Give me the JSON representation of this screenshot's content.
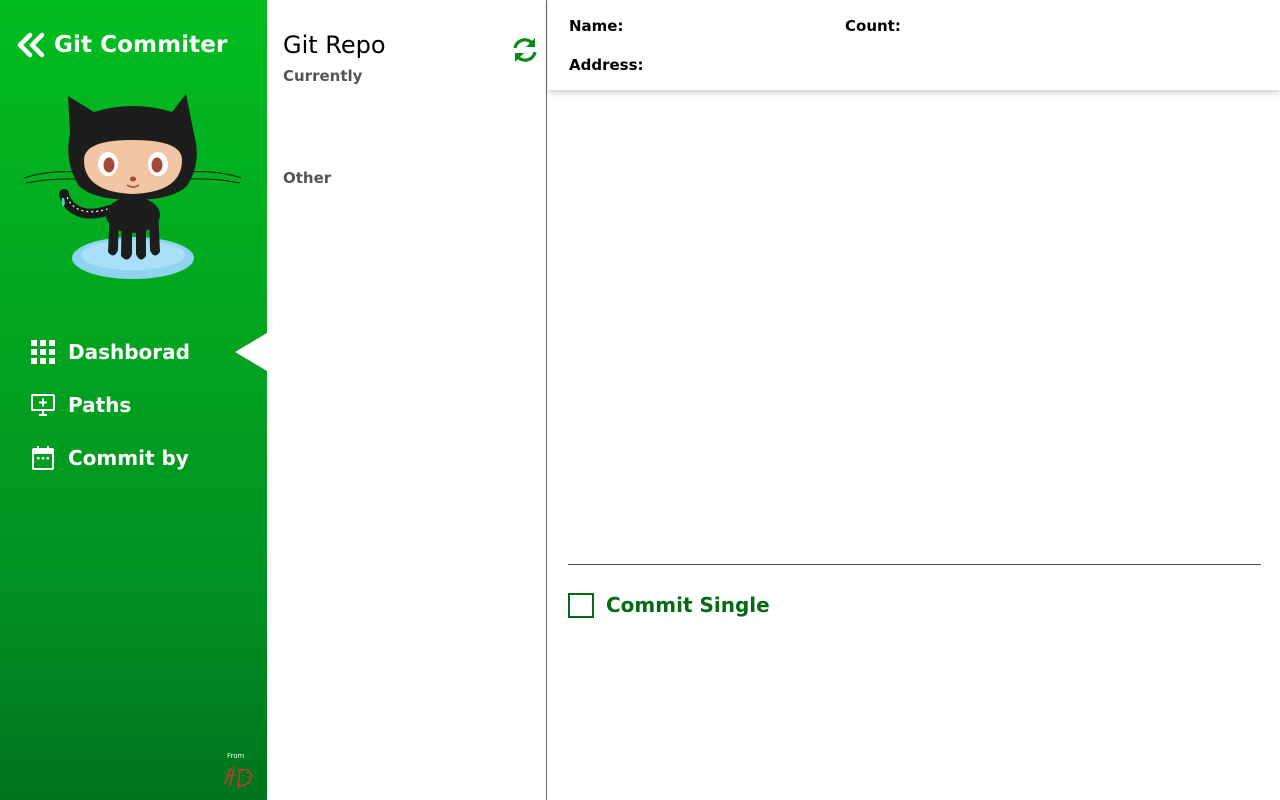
{
  "sidebar": {
    "app_title": "Git Commiter",
    "back_icon": "double-chevron-left-icon",
    "mascot": "octocat-illustration",
    "nav": [
      {
        "label": "Dashborad",
        "icon": "grid-icon",
        "active": true
      },
      {
        "label": "Paths",
        "icon": "monitor-add-icon",
        "active": false
      },
      {
        "label": "Commit by",
        "icon": "calendar-icon",
        "active": false
      }
    ],
    "footer": {
      "from_label": "From",
      "logo": "signature-logo"
    },
    "colors": {
      "gradient_top": "#00bd1f",
      "gradient_bottom": "#00741c"
    }
  },
  "repo_panel": {
    "title": "Git Repo",
    "refresh_icon": "refresh-icon",
    "section_current": "Currently",
    "section_other": "Other"
  },
  "details": {
    "name_label": "Name:",
    "count_label": "Count:",
    "address_label": "Address:",
    "commit_single_label": "Commit Single",
    "commit_single_checked": false,
    "accent_color": "#036b13"
  }
}
